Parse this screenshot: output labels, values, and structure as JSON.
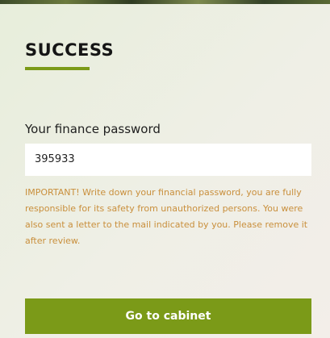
{
  "dialog": {
    "title": "SUCCESS",
    "password_label": "Your finance password",
    "password_value": "395933",
    "notice": "IMPORTANT! Write down your financial password, you are fully responsible for its safety from unauthorized persons. You were also sent a letter to the mail indicated by you. Please remove it after review.",
    "cta_label": "Go to cabinet"
  },
  "colors": {
    "accent": "#7b9a18",
    "notice_text": "#c98f3c",
    "title_text": "#151515"
  }
}
